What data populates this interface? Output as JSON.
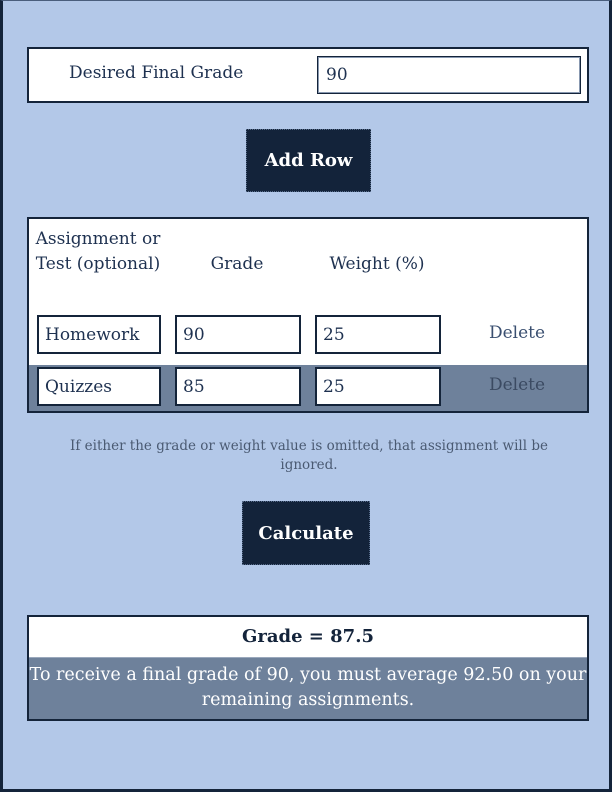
{
  "desired": {
    "label": "Desired Final Grade",
    "value": "90"
  },
  "buttons": {
    "add_row": "Add Row",
    "calculate": "Calculate"
  },
  "table": {
    "headers": {
      "assignment": "Assignment or Test (optional)",
      "grade": "Grade",
      "weight": "Weight (%)"
    },
    "rows": [
      {
        "name": "Homework",
        "grade": "90",
        "weight": "25",
        "delete": "Delete"
      },
      {
        "name": "Quizzes",
        "grade": "85",
        "weight": "25",
        "delete": "Delete"
      }
    ]
  },
  "note": "If either the grade or weight value is omitted, that assignment will be ignored.",
  "result": {
    "grade": "Grade = 87.5",
    "message": "To receive a final grade of 90, you must average 92.50 on your remaining assignments."
  },
  "colors": {
    "background": "#b3c8e8",
    "navy": "#13233a",
    "row_alt": "#6e819b"
  }
}
